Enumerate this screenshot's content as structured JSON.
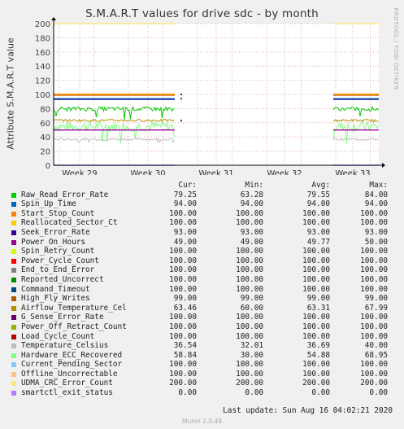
{
  "chart_data": {
    "type": "line",
    "title": "S.M.A.R.T values for drive sdc - by month",
    "ylabel": "Attribute S.M.A.R.T value",
    "ylim": [
      0,
      200
    ],
    "yticks": [
      0,
      20,
      40,
      60,
      80,
      100,
      120,
      140,
      160,
      180,
      200
    ],
    "xticks": [
      "Week 29",
      "Week 30",
      "Week 31",
      "Week 32",
      "Week 33"
    ],
    "grid": true,
    "watermark": "RRDTOOL / TOBI OETIKER",
    "columns": [
      "Cur:",
      "Min:",
      "Avg:",
      "Max:"
    ],
    "series": [
      {
        "name": "Raw_Read_Error_Rate",
        "color": "#00cc00",
        "cur": "79.25",
        "min": "63.28",
        "avg": "79.55",
        "max": "84.00"
      },
      {
        "name": "Spin_Up_Time",
        "color": "#0066b3",
        "cur": "94.00",
        "min": "94.00",
        "avg": "94.00",
        "max": "94.00"
      },
      {
        "name": "Start_Stop_Count",
        "color": "#ff8000",
        "cur": "100.00",
        "min": "100.00",
        "avg": "100.00",
        "max": "100.00"
      },
      {
        "name": "Reallocated_Sector_Ct",
        "color": "#ffcc00",
        "cur": "100.00",
        "min": "100.00",
        "avg": "100.00",
        "max": "100.00"
      },
      {
        "name": "Seek_Error_Rate",
        "color": "#330099",
        "cur": "93.00",
        "min": "93.00",
        "avg": "93.00",
        "max": "93.00"
      },
      {
        "name": "Power_On_Hours",
        "color": "#990099",
        "cur": "49.00",
        "min": "49.00",
        "avg": "49.77",
        "max": "50.00"
      },
      {
        "name": "Spin_Retry_Count",
        "color": "#ccff00",
        "cur": "100.00",
        "min": "100.00",
        "avg": "100.00",
        "max": "100.00"
      },
      {
        "name": "Power_Cycle_Count",
        "color": "#ff0000",
        "cur": "100.00",
        "min": "100.00",
        "avg": "100.00",
        "max": "100.00"
      },
      {
        "name": "End_to_End_Error",
        "color": "#808080",
        "cur": "100.00",
        "min": "100.00",
        "avg": "100.00",
        "max": "100.00"
      },
      {
        "name": "Reported_Uncorrect",
        "color": "#008f00",
        "cur": "100.00",
        "min": "100.00",
        "avg": "100.00",
        "max": "100.00"
      },
      {
        "name": "Command_Timeout",
        "color": "#00487d",
        "cur": "100.00",
        "min": "100.00",
        "avg": "100.00",
        "max": "100.00"
      },
      {
        "name": "High_Fly_Writes",
        "color": "#b35a00",
        "cur": "99.00",
        "min": "99.00",
        "avg": "99.00",
        "max": "99.00"
      },
      {
        "name": "Airflow_Temperature_Cel",
        "color": "#b38f00",
        "cur": "63.46",
        "min": "60.00",
        "avg": "63.31",
        "max": "67.99"
      },
      {
        "name": "G_Sense_Error_Rate",
        "color": "#6b006b",
        "cur": "100.00",
        "min": "100.00",
        "avg": "100.00",
        "max": "100.00"
      },
      {
        "name": "Power_Off_Retract_Count",
        "color": "#8fb300",
        "cur": "100.00",
        "min": "100.00",
        "avg": "100.00",
        "max": "100.00"
      },
      {
        "name": "Load_Cycle_Count",
        "color": "#b30000",
        "cur": "100.00",
        "min": "100.00",
        "avg": "100.00",
        "max": "100.00"
      },
      {
        "name": "Temperature_Celsius",
        "color": "#bebebe",
        "cur": "36.54",
        "min": "32.01",
        "avg": "36.69",
        "max": "40.00"
      },
      {
        "name": "Hardware_ECC_Recovered",
        "color": "#80ff80",
        "cur": "58.84",
        "min": "30.00",
        "avg": "54.88",
        "max": "68.95"
      },
      {
        "name": "Current_Pending_Sector",
        "color": "#80c9ff",
        "cur": "100.00",
        "min": "100.00",
        "avg": "100.00",
        "max": "100.00"
      },
      {
        "name": "Offline_Uncorrectable",
        "color": "#ffc080",
        "cur": "100.00",
        "min": "100.00",
        "avg": "100.00",
        "max": "100.00"
      },
      {
        "name": "UDMA_CRC_Error_Count",
        "color": "#ffe680",
        "cur": "200.00",
        "min": "200.00",
        "avg": "200.00",
        "max": "200.00"
      },
      {
        "name": "smartctl_exit_status",
        "color": "#aa80ff",
        "cur": "0.00",
        "min": "0.00",
        "avg": "0.00",
        "max": "0.00"
      }
    ]
  },
  "last_update": "Last update: Sun Aug 16 04:02:21 2020",
  "footer": "Munin 2.0.49"
}
